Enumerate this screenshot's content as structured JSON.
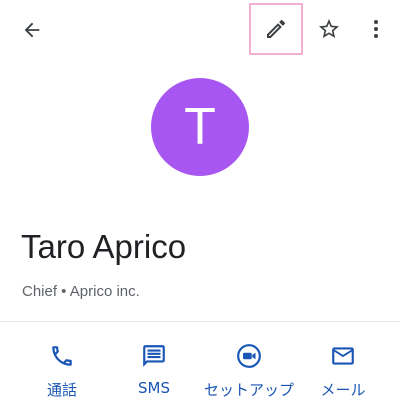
{
  "colors": {
    "accent": "#1a56b5",
    "avatar_bg": "#a856f2",
    "text_primary": "#202124",
    "text_secondary": "#5f6368",
    "icon_gray": "#3c4043",
    "highlight_border": "#f2b1d0"
  },
  "toolbar": {
    "back_icon": "arrow-left-icon",
    "edit_icon": "pencil-icon",
    "star_icon": "star-outline-icon",
    "more_icon": "more-vert-icon"
  },
  "contact": {
    "avatar_letter": "T",
    "name": "Taro Aprico",
    "subtitle": "Chief • Aprico inc."
  },
  "actions": [
    {
      "label": "通話",
      "icon": "phone-icon"
    },
    {
      "label": "SMS",
      "icon": "message-icon"
    },
    {
      "label": "セットアップ",
      "icon": "video-icon"
    },
    {
      "label": "メール",
      "icon": "mail-icon"
    }
  ]
}
